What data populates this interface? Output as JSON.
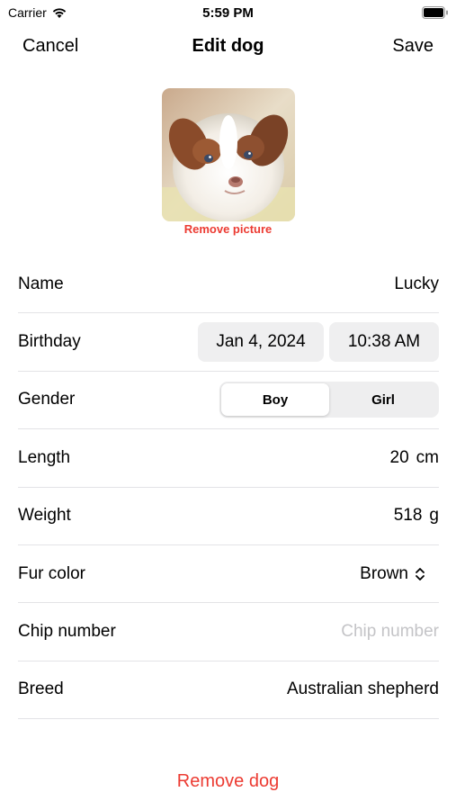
{
  "status_bar": {
    "carrier": "Carrier",
    "time": "5:59 PM"
  },
  "nav": {
    "cancel_label": "Cancel",
    "title": "Edit dog",
    "save_label": "Save"
  },
  "photo": {
    "remove_label": "Remove picture"
  },
  "form": {
    "name": {
      "label": "Name",
      "value": "Lucky"
    },
    "birthday": {
      "label": "Birthday",
      "date": "Jan 4, 2024",
      "time": "10:38 AM"
    },
    "gender": {
      "label": "Gender",
      "options": [
        "Boy",
        "Girl"
      ],
      "selected": "Boy"
    },
    "length": {
      "label": "Length",
      "value": "20",
      "unit": "cm"
    },
    "weight": {
      "label": "Weight",
      "value": "518",
      "unit": "g"
    },
    "fur_color": {
      "label": "Fur color",
      "value": "Brown"
    },
    "chip_number": {
      "label": "Chip number",
      "value": "",
      "placeholder": "Chip number"
    },
    "breed": {
      "label": "Breed",
      "value": "Australian shepherd"
    }
  },
  "remove_dog_label": "Remove dog",
  "colors": {
    "destructive": "#ec3b32",
    "separator": "#e3e3e6",
    "pill_bg": "#efeff0",
    "placeholder": "#c4c4c7"
  },
  "icons": {
    "wifi": "wifi-icon",
    "battery": "battery-icon",
    "fur_menu": "chevron-up-down-icon"
  }
}
